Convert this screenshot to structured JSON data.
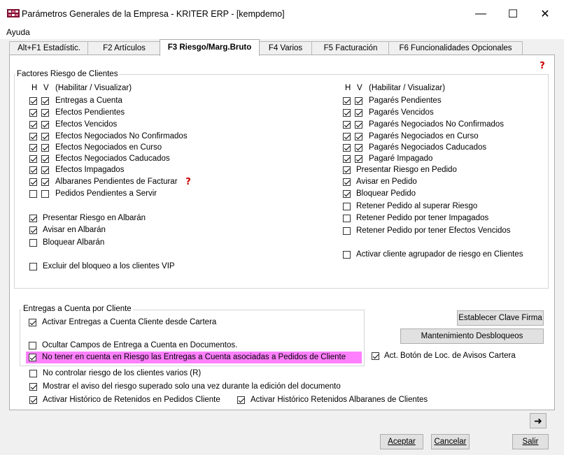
{
  "window": {
    "title": "Parámetros Generales de la Empresa - KRITER ERP - [kempdemo]",
    "minimize_glyph": "—",
    "maximize_glyph": "☐",
    "close_glyph": "✕"
  },
  "menu": {
    "help_label": "Ayuda"
  },
  "tabs": [
    {
      "label": "Alt+F1 Estadístic.",
      "active": false
    },
    {
      "label": "F2 Artículos",
      "active": false
    },
    {
      "label": "F3 Riesgo/Marg.Bruto",
      "active": true
    },
    {
      "label": "F4 Varios",
      "active": false
    },
    {
      "label": "F5 Facturación",
      "active": false
    },
    {
      "label": "F6 Funcionalidades Opcionales",
      "active": false
    }
  ],
  "risk_group": {
    "title": "Factores Riesgo de Clientes",
    "header_h": "H",
    "header_v": "V",
    "header_desc": "(Habilitar / Visualizar)",
    "left_pairs": [
      {
        "label": "Entregas a Cuenta",
        "h": true,
        "v": true
      },
      {
        "label": "Efectos Pendientes",
        "h": true,
        "v": true
      },
      {
        "label": "Efectos Vencidos",
        "h": true,
        "v": true
      },
      {
        "label": "Efectos Negociados No Confirmados",
        "h": true,
        "v": true
      },
      {
        "label": "Efectos Negociados en Curso",
        "h": true,
        "v": true
      },
      {
        "label": "Efectos Negociados Caducados",
        "h": true,
        "v": true
      },
      {
        "label": "Efectos Impagados",
        "h": true,
        "v": true
      },
      {
        "label": "Albaranes Pendientes de Facturar",
        "h": true,
        "v": true
      },
      {
        "label": "Pedidos Pendientes a Servir",
        "h": false,
        "v": false
      }
    ],
    "left_singles": [
      {
        "label": "Presentar Riesgo en Albarán",
        "checked": true
      },
      {
        "label": "Avisar en Albarán",
        "checked": true
      },
      {
        "label": "Bloquear Albarán",
        "checked": false
      },
      {
        "label": "Excluir del bloqueo a los clientes VIP",
        "checked": false
      }
    ],
    "right_pairs": [
      {
        "label": "Pagarés Pendientes",
        "h": true,
        "v": true
      },
      {
        "label": "Pagarés Vencidos",
        "h": true,
        "v": true
      },
      {
        "label": "Pagarés Negociados No Confirmados",
        "h": true,
        "v": true
      },
      {
        "label": "Pagarés Negociados en Curso",
        "h": true,
        "v": true
      },
      {
        "label": "Pagarés Negociados Caducados",
        "h": true,
        "v": true
      },
      {
        "label": "Pagaré Impagado",
        "h": true,
        "v": true
      }
    ],
    "right_singles": [
      {
        "label": "Presentar Riesgo en Pedido",
        "checked": true
      },
      {
        "label": "Avisar en Pedido",
        "checked": true
      },
      {
        "label": "Bloquear Pedido",
        "checked": true
      },
      {
        "label": "Retener Pedido al superar Riesgo",
        "checked": false
      },
      {
        "label": "Retener Pedido por tener Impagados",
        "checked": false
      },
      {
        "label": "Retener Pedido por tener Efectos Vencidos",
        "checked": false
      },
      {
        "label": "Activar cliente agrupador de riesgo en Clientes",
        "checked": false
      }
    ]
  },
  "entregas_group": {
    "title": "Entregas a Cuenta por Cliente",
    "items": [
      {
        "label": "Activar Entregas a Cuenta Cliente desde Cartera",
        "checked": true
      },
      {
        "label": "Ocultar Campos de Entrega a Cuenta en Documentos.",
        "checked": false
      },
      {
        "label": "No tener en cuenta en Riesgo las Entregas a Cuenta asociadas a Pedidos de Cliente",
        "checked": true
      }
    ]
  },
  "bottom_options": [
    {
      "label": "No controlar riesgo de los clientes varios (R)",
      "checked": false
    },
    {
      "label": "Mostrar el aviso del riesgo superado solo una vez durante la edición del documento",
      "checked": true
    },
    {
      "label": "Activar Histórico de Retenidos en Pedidos Cliente",
      "checked": true
    },
    {
      "label": "Activar Histórico Retenidos Albaranes de Clientes",
      "checked": true
    }
  ],
  "side_controls": {
    "set_key_button": "Establecer Clave Firma",
    "unlock_button": "Mantenimiento Desbloqueos",
    "alerts_button_option": {
      "label": "Act. Botón de Loc. de Avisos Cartera",
      "checked": true
    },
    "next_glyph": "➜"
  },
  "footer": {
    "accept": "Aceptar",
    "cancel": "Cancelar",
    "exit": "Salir"
  },
  "colors": {
    "highlight": "#ff80ff",
    "face": "#f0f0f0",
    "help_red": "#cc0000"
  }
}
